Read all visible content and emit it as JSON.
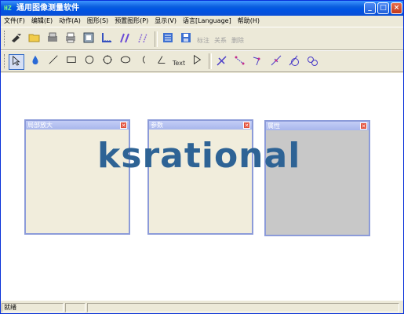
{
  "window": {
    "app_icon": "HZ",
    "title": "通用图像测量软件",
    "buttons": {
      "minimize": "_",
      "maximize": "□",
      "close": "×"
    }
  },
  "menubar": [
    "文件(F)",
    "编辑(E)",
    "动作(A)",
    "图形(S)",
    "预置图形(P)",
    "显示(V)",
    "语言[Language]",
    "帮助(H)"
  ],
  "toolbar1": {
    "buttons": [
      "camera-icon",
      "open-folder-icon",
      "scanner-icon",
      "print-icon",
      "calibrate-icon",
      "scale-icon",
      "curve-icon",
      "double-curve-icon",
      "list-icon",
      "save-icon"
    ],
    "disabled_labels": [
      "标注",
      "关系",
      "删除"
    ]
  },
  "toolbar2": {
    "text_tool_label": "Text",
    "buttons": [
      "select-arrow-icon",
      "fill-drop-icon",
      "line-icon",
      "rectangle-icon",
      "circle-icon",
      "dotted-circle-icon",
      "ellipse-icon",
      "arc-icon",
      "angle-icon",
      "text-icon",
      "triangle-icon",
      "measure-1-icon",
      "measure-2-icon",
      "measure-3-icon",
      "measure-4-icon",
      "measure-5-icon",
      "measure-6-icon"
    ]
  },
  "panels": [
    {
      "title": "局部放大"
    },
    {
      "title": "参数"
    },
    {
      "title": "属性"
    }
  ],
  "watermark": "ksrational",
  "status": {
    "text": "就绪"
  }
}
